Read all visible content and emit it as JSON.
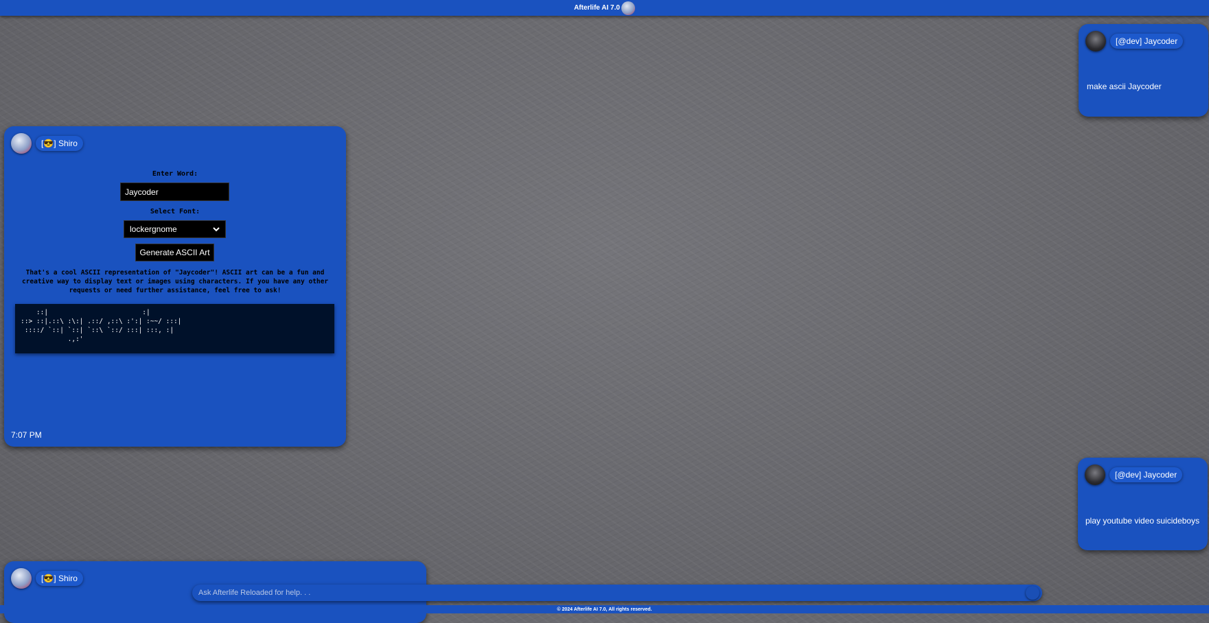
{
  "app": {
    "title": "Afterlife AI 7.0",
    "footer": "© 2024 Afterlife AI 7.0, All rights reserved."
  },
  "messages": [
    {
      "author": "[@dev] Jaycoder",
      "text": "make ascii Jaycoder"
    },
    {
      "author": "[😎] Shiro",
      "form": {
        "word_label": "Enter Word:",
        "word_value": "Jaycoder",
        "font_label": "Select Font:",
        "font_value": "lockergnome",
        "button_label": "Generate ASCII Art"
      },
      "reply": "That's a cool ASCII representation of \"Jaycoder\"! ASCII art can be a fun and creative way to display text or images using characters. If you have any other requests or need further assistance, feel free to ask!",
      "ascii": "    ::|                        :|\n::> ::|.::\\ :\\:| .::/ ,::\\ :':| :~~/ :::|\n ::::/ `::| `::| `::\\ `::/ :::| :::, :|\n            .,:'",
      "time": "7:07 PM"
    },
    {
      "author": "[@dev] Jaycoder",
      "text": "play youtube video suicideboys"
    },
    {
      "author": "[😎] Shiro"
    }
  ],
  "composer": {
    "placeholder": "Ask Afterlife Reloaded for help. . ."
  }
}
